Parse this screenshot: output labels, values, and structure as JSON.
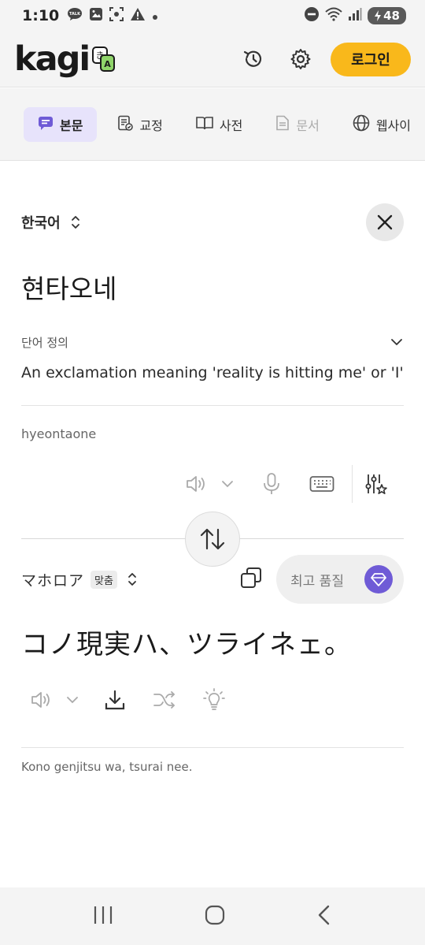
{
  "status_bar": {
    "time": "1:10",
    "battery": "48"
  },
  "header": {
    "logo": "kagi",
    "login_label": "로그인"
  },
  "tabs": [
    {
      "label": "본문",
      "icon": "text-bubble-icon",
      "active": true
    },
    {
      "label": "교정",
      "icon": "proofread-icon",
      "active": false
    },
    {
      "label": "사전",
      "icon": "book-icon",
      "active": false
    },
    {
      "label": "문서",
      "icon": "document-icon",
      "active": false,
      "disabled": true
    },
    {
      "label": "웹사이",
      "icon": "globe-icon",
      "active": false
    }
  ],
  "source": {
    "language": "한국어",
    "text": "현타오네",
    "definition_title": "단어 정의",
    "definition_text": "An exclamation meaning 'reality is hitting me' or 'I'...",
    "romanization": "hyeontaone"
  },
  "target": {
    "language": "マホロア",
    "badge": "맞춤",
    "quality_label": "최고 품질",
    "text": "コノ現実ハ、ツライネェ。",
    "romanization": "Kono genjitsu wa, tsurai nee."
  },
  "colors": {
    "accent_yellow": "#f9b81b",
    "accent_purple": "#6f5bd6",
    "active_tab_bg": "#e7e3fb"
  }
}
